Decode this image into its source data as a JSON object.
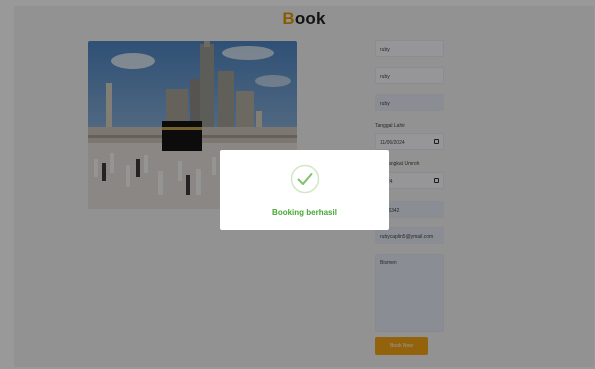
{
  "page": {
    "title_first": "B",
    "title_rest": "ook",
    "brand_color": "#e19a00"
  },
  "hero": {
    "icon": "kaaba-photo"
  },
  "form": {
    "name1_value": "ruby",
    "name2_value": "ruby",
    "name3_value": "ruby",
    "date1_label": "Tanggal Lahir",
    "date1_value": "11/06/2024",
    "date2_label": "al Berangkat Umroh",
    "date2_value": "/2024",
    "phone_value": "1096342",
    "email_value": "rubycaplin5@ymail.com",
    "notes_value": "Bismen",
    "submit_label": "Book Now",
    "button_color": "#f3a417"
  },
  "modal": {
    "icon": "check-circle-icon",
    "message": "Booking berhasil",
    "accent_color": "#45a834"
  }
}
